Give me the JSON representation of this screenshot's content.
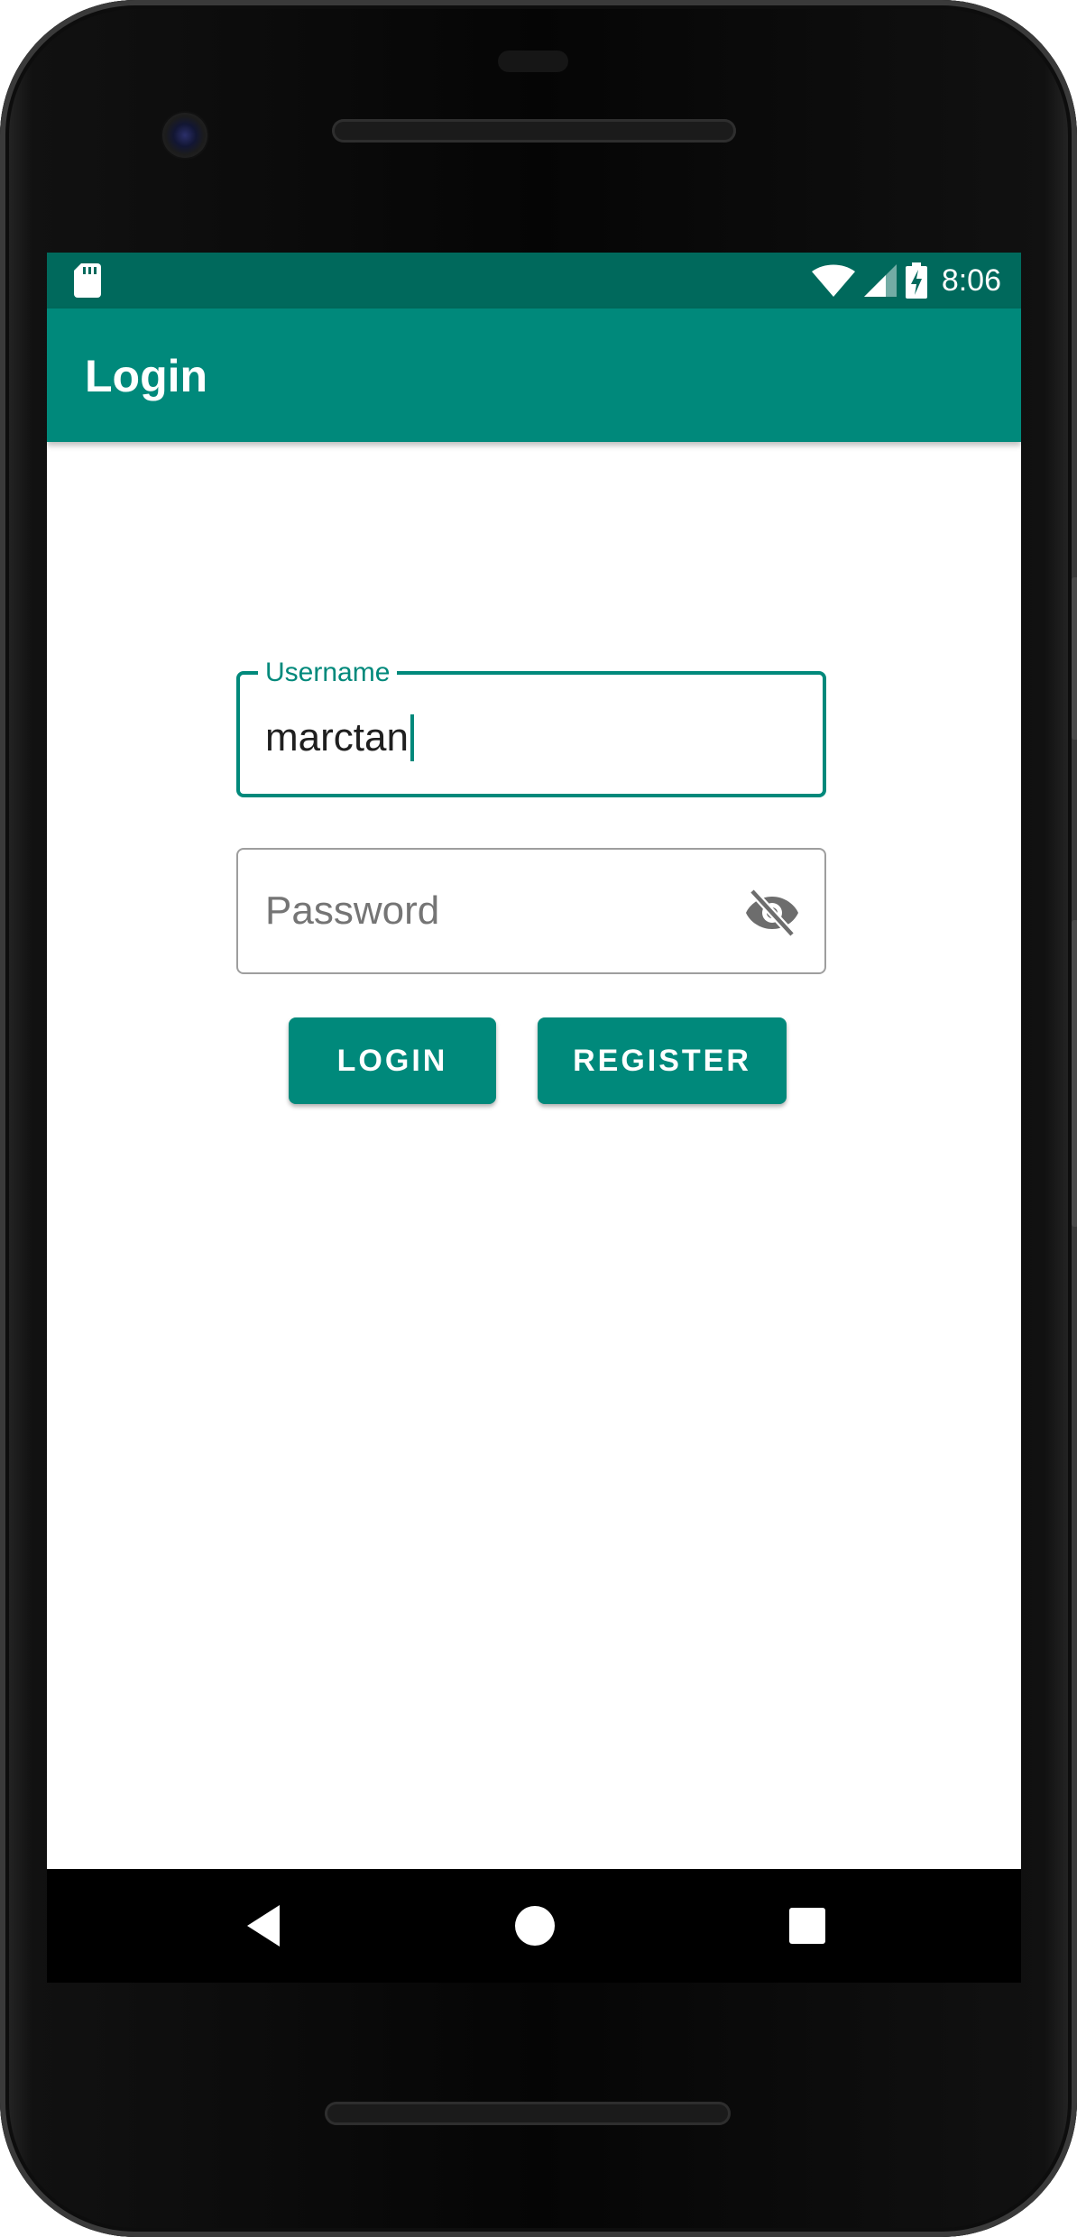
{
  "status_bar": {
    "time": "8:06",
    "left_icon": "sd-card-icon",
    "icons": [
      "wifi-icon",
      "signal-icon",
      "battery-charging-icon"
    ]
  },
  "app_bar": {
    "title": "Login"
  },
  "form": {
    "username": {
      "label": "Username",
      "value": "marctan"
    },
    "password": {
      "placeholder": "Password",
      "toggle_icon": "visibility-off-icon"
    }
  },
  "buttons": {
    "login": "LOGIN",
    "register": "REGISTER"
  },
  "nav_bar": {
    "icons": [
      "back-icon",
      "home-icon",
      "recents-icon"
    ]
  },
  "colors": {
    "primary": "#00897b",
    "primary_dark": "#00695c",
    "field_border": "#9e9e9e",
    "placeholder": "#757575"
  }
}
